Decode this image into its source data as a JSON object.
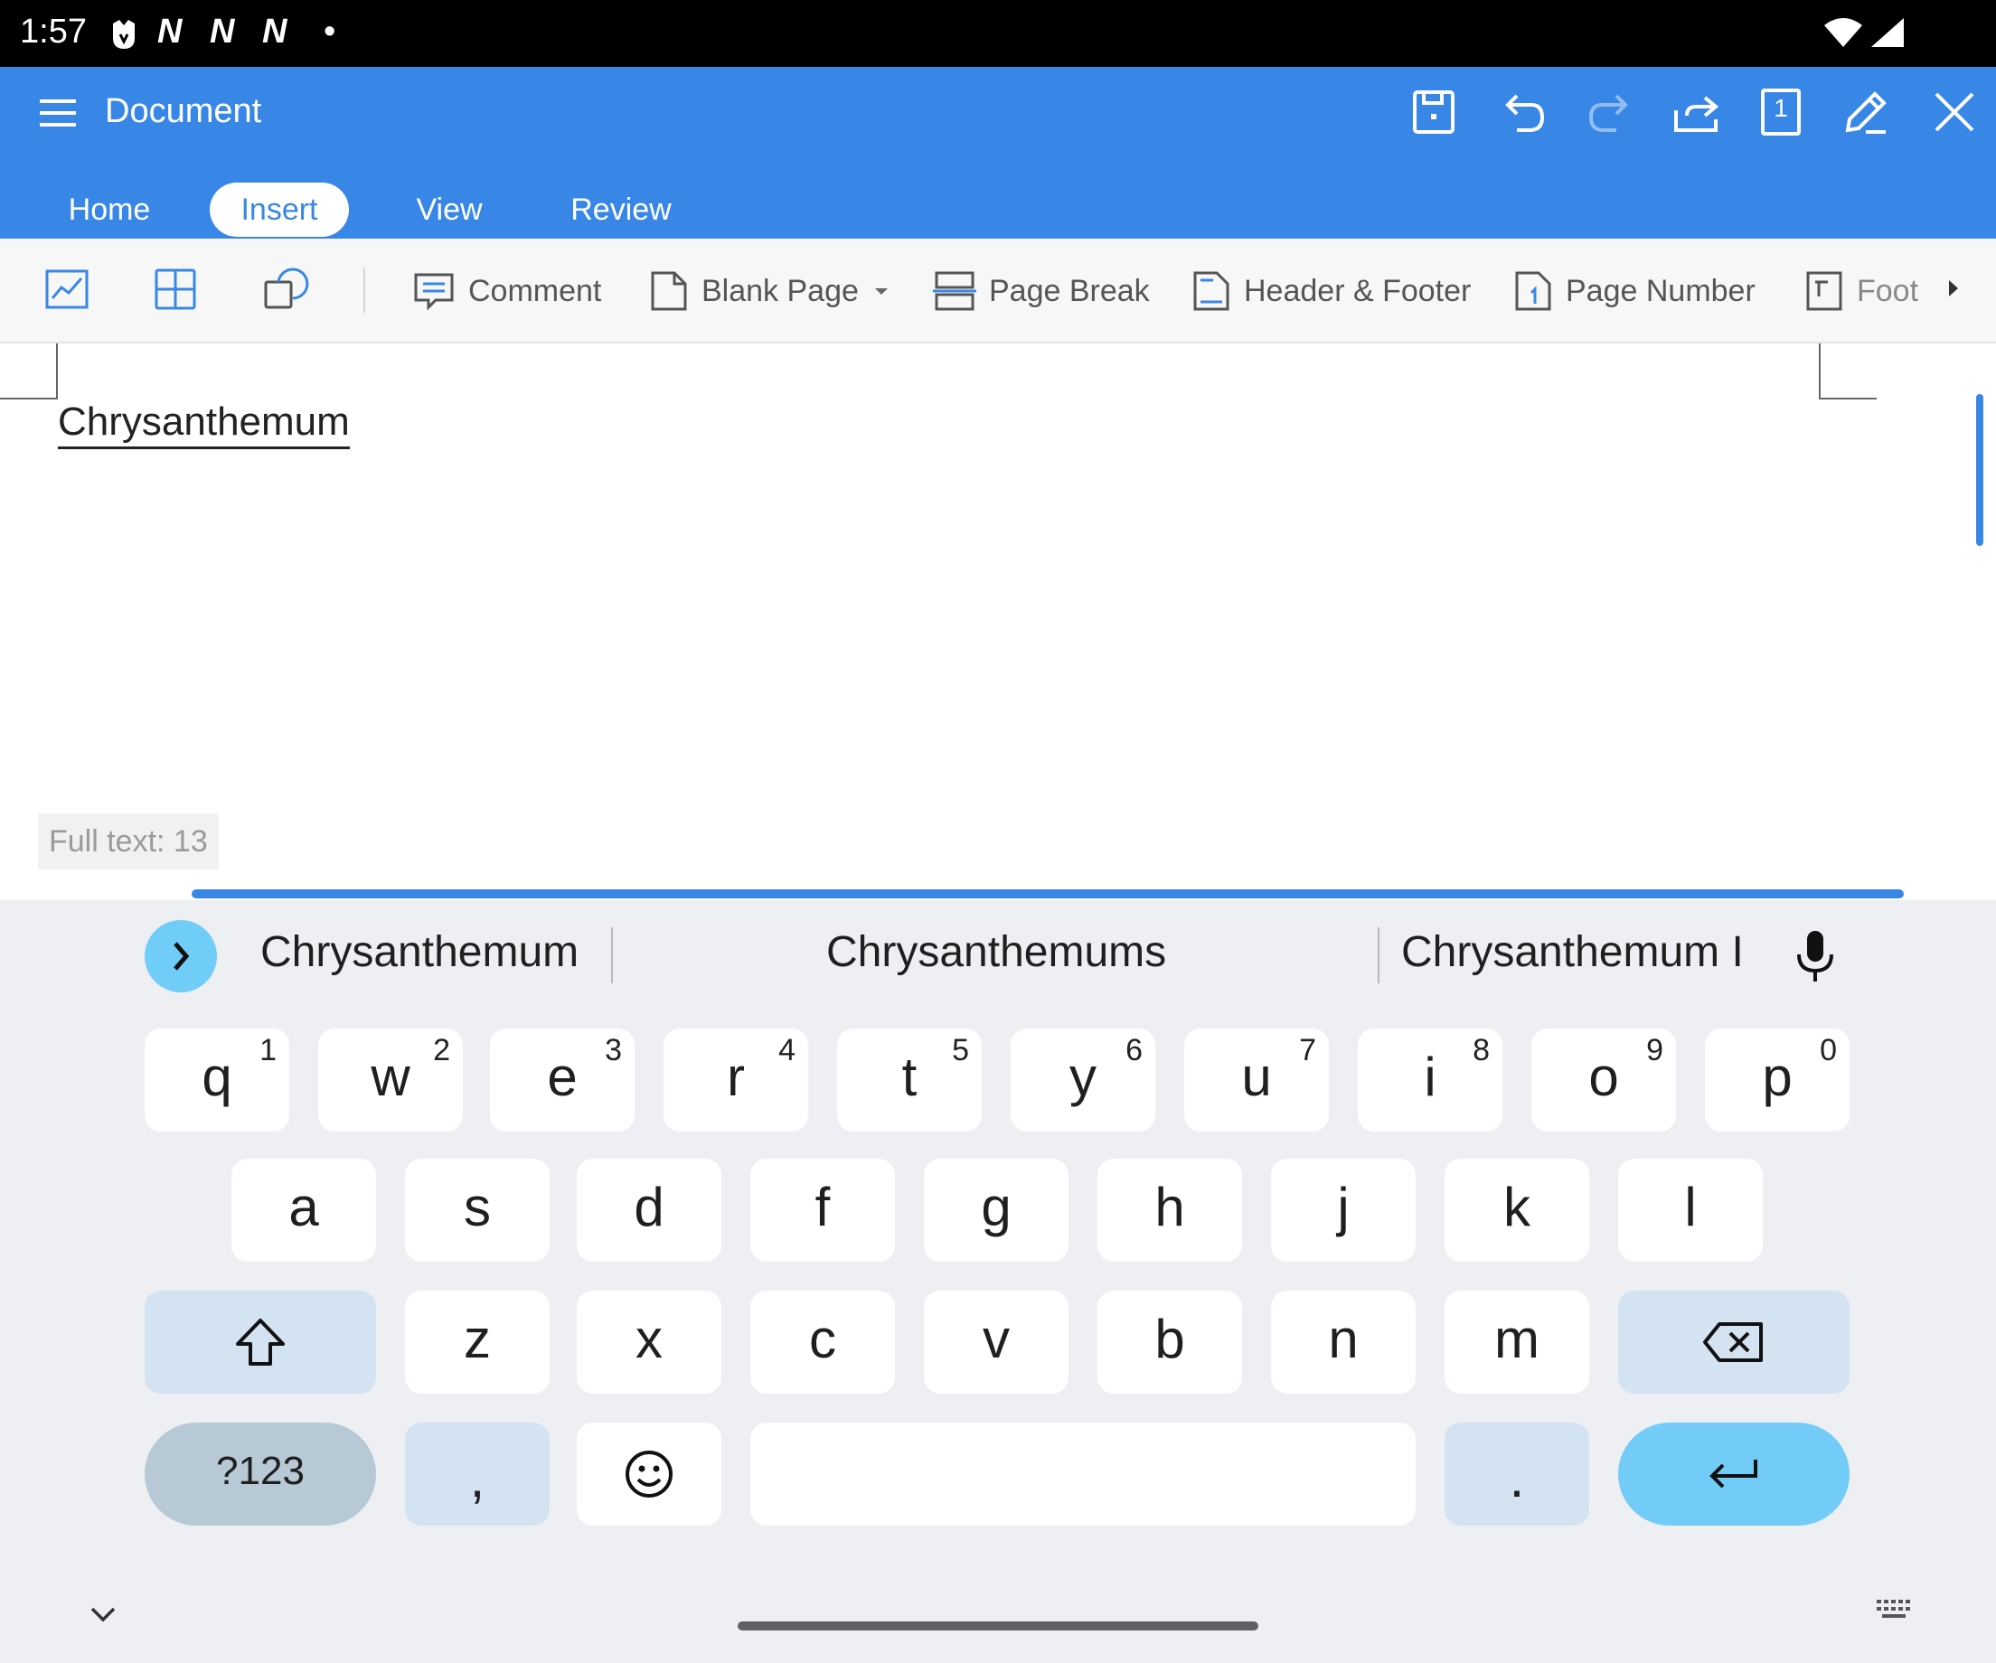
{
  "status_bar": {
    "time": "1:57",
    "notification_icons": "N N N",
    "dot": "•"
  },
  "app_bar": {
    "title": "Document",
    "tabs": [
      {
        "label": "Home"
      },
      {
        "label": "Insert",
        "active": true
      },
      {
        "label": "View"
      },
      {
        "label": "Review"
      }
    ],
    "actions": [
      "save-icon",
      "undo-icon",
      "redo-icon",
      "share-icon",
      "page-count-icon",
      "edit-icon",
      "close-icon"
    ],
    "page_count": "1"
  },
  "toolbar": {
    "items": {
      "comment": "Comment",
      "blank_page": "Blank Page",
      "page_break": "Page Break",
      "header_footer": "Header & Footer",
      "page_number": "Page Number",
      "footnote": "Foot"
    }
  },
  "document": {
    "text": "Chrysanthemum",
    "full_text_label": "Full text: 13"
  },
  "keyboard": {
    "suggestions": [
      "Chrysanthemum",
      "Chrysanthemums",
      "Chrysanthemum I"
    ],
    "row1": [
      {
        "key": "q",
        "hint": "1"
      },
      {
        "key": "w",
        "hint": "2"
      },
      {
        "key": "e",
        "hint": "3"
      },
      {
        "key": "r",
        "hint": "4"
      },
      {
        "key": "t",
        "hint": "5"
      },
      {
        "key": "y",
        "hint": "6"
      },
      {
        "key": "u",
        "hint": "7"
      },
      {
        "key": "i",
        "hint": "8"
      },
      {
        "key": "o",
        "hint": "9"
      },
      {
        "key": "p",
        "hint": "0"
      }
    ],
    "row2": [
      "a",
      "s",
      "d",
      "f",
      "g",
      "h",
      "j",
      "k",
      "l"
    ],
    "row3": [
      "z",
      "x",
      "c",
      "v",
      "b",
      "n",
      "m"
    ],
    "symbols_label": "?123",
    "comma": ",",
    "period": "."
  },
  "colors": {
    "accent": "#3887e6",
    "keyboard_bg": "#eeeff3",
    "enter_key": "#73ccf8"
  }
}
